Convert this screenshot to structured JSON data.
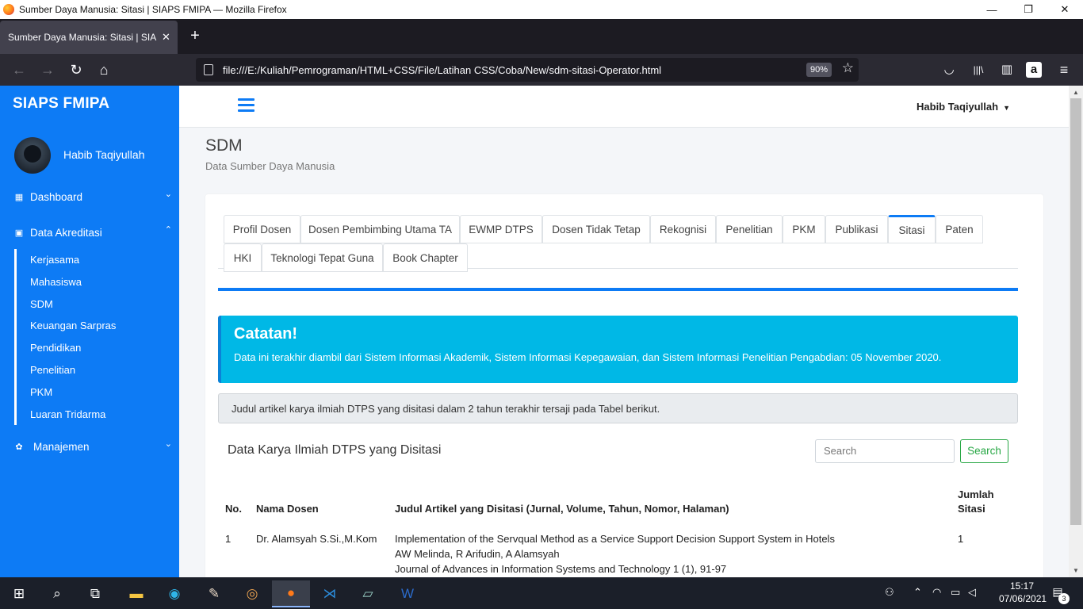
{
  "window": {
    "title": "Sumber Daya Manusia: Sitasi | SIAPS FMIPA — Mozilla Firefox",
    "minimize": "—",
    "restore": "❐",
    "close": "✕"
  },
  "browser": {
    "tab_title": "Sumber Daya Manusia: Sitasi | SIAPS FMIPA",
    "tab_close": "✕",
    "new_tab": "+",
    "url": "file:///E:/Kuliah/Pemrograman/HTML+CSS/File/Latihan CSS/Coba/New/sdm-sitasi-Operator.html",
    "zoom": "90%",
    "icons": {
      "back": "←",
      "forward": "→",
      "reload": "↻",
      "home": "⌂",
      "star": "☆",
      "pocket": "◡",
      "library": "|||\\",
      "sidebar": "▥",
      "amazon": "a",
      "menu": "≡"
    }
  },
  "sidebar": {
    "brand": "SIAPS FMIPA",
    "user_name": "Habib Taqiyullah",
    "menu": [
      {
        "label": "Dashboard",
        "icon": "▦",
        "chevron": "⌄"
      },
      {
        "label": "Data Akreditasi",
        "icon": "▣",
        "chevron": "⌃"
      },
      {
        "label": "Manajemen",
        "icon": "✿",
        "chevron": "⌄"
      }
    ],
    "sub_items": [
      "Kerjasama",
      "Mahasiswa",
      "SDM",
      "Keuangan Sarpras",
      "Pendidikan",
      "Penelitian",
      "PKM",
      "Luaran Tridarma"
    ]
  },
  "topnav": {
    "user": "Habib Taqiyullah",
    "caret": "▼"
  },
  "page": {
    "title": "SDM",
    "subtitle": "Data Sumber Daya Manusia"
  },
  "tabs": {
    "row1": [
      "Profil Dosen",
      "Dosen Pembimbing Utama TA",
      "EWMP DTPS",
      "Dosen Tidak Tetap",
      "Rekognisi",
      "Penelitian",
      "PKM",
      "Publikasi",
      "Sitasi",
      "Paten"
    ],
    "row2": [
      "HKI",
      "Teknologi Tepat Guna",
      "Book Chapter"
    ],
    "active": "Sitasi"
  },
  "callout": {
    "title": "Catatan!",
    "body": "Data ini terakhir diambil dari Sistem Informasi Akademik, Sistem Informasi Kepegawaian, dan Sistem Informasi Penelitian Pengabdian: 05 November 2020."
  },
  "info": "Judul artikel karya ilmiah DTPS yang disitasi dalam 2 tahun terakhir tersaji pada Tabel berikut.",
  "table": {
    "title": "Data Karya Ilmiah DTPS yang Disitasi",
    "search_placeholder": "Search",
    "search_button": "Search",
    "headers": {
      "no": "No.",
      "nama": "Nama Dosen",
      "judul": "Judul Artikel yang Disitasi (Jurnal, Volume, Tahun, Nomor, Halaman)",
      "jumlah_1": "Jumlah",
      "jumlah_2": "Sitasi"
    },
    "rows": [
      {
        "no": "1",
        "nama": "Dr. Alamsyah S.Si.,M.Kom",
        "judul_line1": "Implementation of the Servqual Method as a Service Support Decision Support System in Hotels",
        "judul_line2": "AW Melinda, R Arifudin, A Alamsyah",
        "judul_line3": "Journal of Advances in Information Systems and Technology 1 (1), 91-97",
        "jumlah": "1"
      }
    ]
  },
  "taskbar": {
    "time": "15:17",
    "date": "07/06/2021",
    "notifications": "3"
  }
}
